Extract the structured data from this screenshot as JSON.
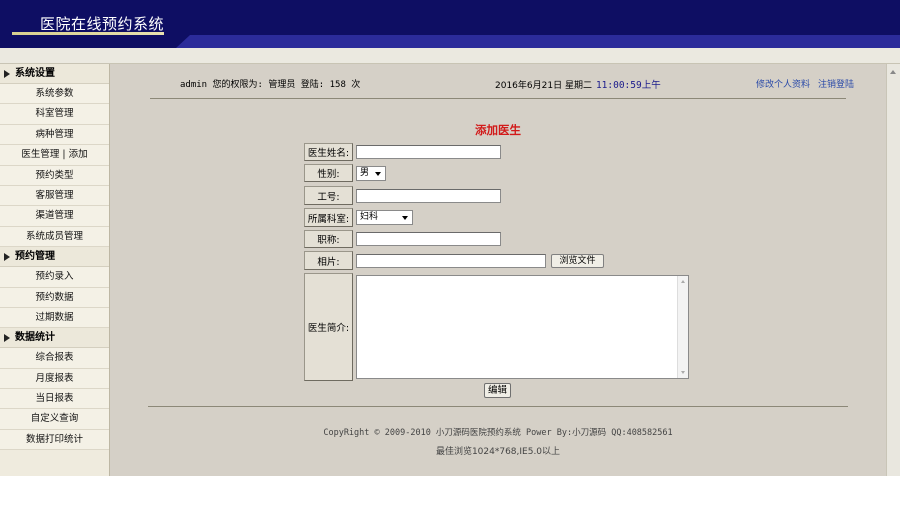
{
  "header": {
    "title": "医院在线预约系统"
  },
  "sidebar": {
    "groups": [
      {
        "title": "系统设置",
        "items": [
          "系统参数",
          "科室管理",
          "病种管理",
          "医生管理 | 添加",
          "预约类型",
          "客服管理",
          "渠道管理",
          "系统成员管理"
        ]
      },
      {
        "title": "预约管理",
        "items": [
          "预约录入",
          "预约数据",
          "过期数据"
        ]
      },
      {
        "title": "数据统计",
        "items": [
          "综合报表",
          "月度报表",
          "当日报表",
          "自定义查询",
          "数据打印统计"
        ]
      }
    ]
  },
  "topbar": {
    "user_info": "admin 您的权限为: 管理员 登陆: 158 次",
    "date": "2016年6月21日 星期二",
    "clock": "11:00:59上午",
    "edit_profile": "修改个人资料",
    "logout": "注销登陆"
  },
  "form": {
    "title": "添加医生",
    "name_label": "医生姓名:",
    "gender_label": "性别:",
    "gender_value": "男",
    "job_no_label": "工号:",
    "department_label": "所属科室:",
    "department_value": "妇科",
    "title_label": "职称:",
    "photo_label": "相片:",
    "browse_button": "浏览文件",
    "intro_label": "医生简介:",
    "submit_button": "编辑"
  },
  "footer": {
    "copyright": "CopyRight © 2009-2010 小刀源码医院预约系统 Power By:小刀源码 QQ:408582561",
    "best_view": "最佳浏览1024*768,IE5.0以上"
  }
}
